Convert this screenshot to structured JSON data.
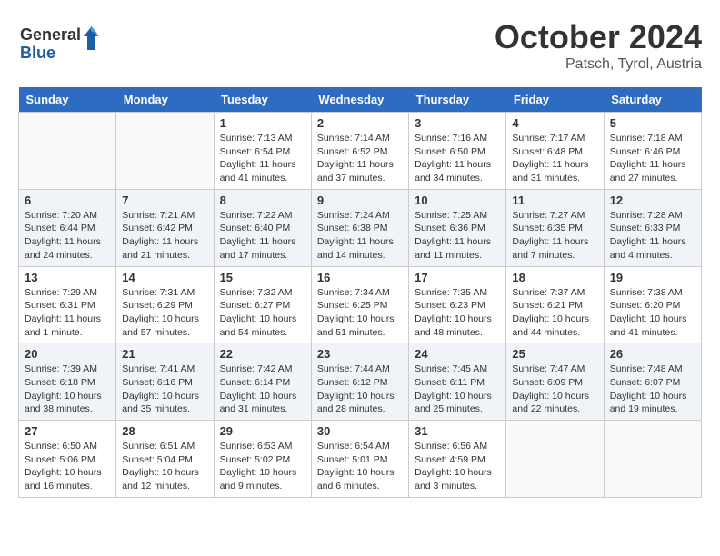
{
  "header": {
    "logo_line1": "General",
    "logo_line2": "Blue",
    "month": "October 2024",
    "location": "Patsch, Tyrol, Austria"
  },
  "weekdays": [
    "Sunday",
    "Monday",
    "Tuesday",
    "Wednesday",
    "Thursday",
    "Friday",
    "Saturday"
  ],
  "weeks": [
    [
      {
        "day": "",
        "sunrise": "",
        "sunset": "",
        "daylight": ""
      },
      {
        "day": "",
        "sunrise": "",
        "sunset": "",
        "daylight": ""
      },
      {
        "day": "1",
        "sunrise": "Sunrise: 7:13 AM",
        "sunset": "Sunset: 6:54 PM",
        "daylight": "Daylight: 11 hours and 41 minutes."
      },
      {
        "day": "2",
        "sunrise": "Sunrise: 7:14 AM",
        "sunset": "Sunset: 6:52 PM",
        "daylight": "Daylight: 11 hours and 37 minutes."
      },
      {
        "day": "3",
        "sunrise": "Sunrise: 7:16 AM",
        "sunset": "Sunset: 6:50 PM",
        "daylight": "Daylight: 11 hours and 34 minutes."
      },
      {
        "day": "4",
        "sunrise": "Sunrise: 7:17 AM",
        "sunset": "Sunset: 6:48 PM",
        "daylight": "Daylight: 11 hours and 31 minutes."
      },
      {
        "day": "5",
        "sunrise": "Sunrise: 7:18 AM",
        "sunset": "Sunset: 6:46 PM",
        "daylight": "Daylight: 11 hours and 27 minutes."
      }
    ],
    [
      {
        "day": "6",
        "sunrise": "Sunrise: 7:20 AM",
        "sunset": "Sunset: 6:44 PM",
        "daylight": "Daylight: 11 hours and 24 minutes."
      },
      {
        "day": "7",
        "sunrise": "Sunrise: 7:21 AM",
        "sunset": "Sunset: 6:42 PM",
        "daylight": "Daylight: 11 hours and 21 minutes."
      },
      {
        "day": "8",
        "sunrise": "Sunrise: 7:22 AM",
        "sunset": "Sunset: 6:40 PM",
        "daylight": "Daylight: 11 hours and 17 minutes."
      },
      {
        "day": "9",
        "sunrise": "Sunrise: 7:24 AM",
        "sunset": "Sunset: 6:38 PM",
        "daylight": "Daylight: 11 hours and 14 minutes."
      },
      {
        "day": "10",
        "sunrise": "Sunrise: 7:25 AM",
        "sunset": "Sunset: 6:36 PM",
        "daylight": "Daylight: 11 hours and 11 minutes."
      },
      {
        "day": "11",
        "sunrise": "Sunrise: 7:27 AM",
        "sunset": "Sunset: 6:35 PM",
        "daylight": "Daylight: 11 hours and 7 minutes."
      },
      {
        "day": "12",
        "sunrise": "Sunrise: 7:28 AM",
        "sunset": "Sunset: 6:33 PM",
        "daylight": "Daylight: 11 hours and 4 minutes."
      }
    ],
    [
      {
        "day": "13",
        "sunrise": "Sunrise: 7:29 AM",
        "sunset": "Sunset: 6:31 PM",
        "daylight": "Daylight: 11 hours and 1 minute."
      },
      {
        "day": "14",
        "sunrise": "Sunrise: 7:31 AM",
        "sunset": "Sunset: 6:29 PM",
        "daylight": "Daylight: 10 hours and 57 minutes."
      },
      {
        "day": "15",
        "sunrise": "Sunrise: 7:32 AM",
        "sunset": "Sunset: 6:27 PM",
        "daylight": "Daylight: 10 hours and 54 minutes."
      },
      {
        "day": "16",
        "sunrise": "Sunrise: 7:34 AM",
        "sunset": "Sunset: 6:25 PM",
        "daylight": "Daylight: 10 hours and 51 minutes."
      },
      {
        "day": "17",
        "sunrise": "Sunrise: 7:35 AM",
        "sunset": "Sunset: 6:23 PM",
        "daylight": "Daylight: 10 hours and 48 minutes."
      },
      {
        "day": "18",
        "sunrise": "Sunrise: 7:37 AM",
        "sunset": "Sunset: 6:21 PM",
        "daylight": "Daylight: 10 hours and 44 minutes."
      },
      {
        "day": "19",
        "sunrise": "Sunrise: 7:38 AM",
        "sunset": "Sunset: 6:20 PM",
        "daylight": "Daylight: 10 hours and 41 minutes."
      }
    ],
    [
      {
        "day": "20",
        "sunrise": "Sunrise: 7:39 AM",
        "sunset": "Sunset: 6:18 PM",
        "daylight": "Daylight: 10 hours and 38 minutes."
      },
      {
        "day": "21",
        "sunrise": "Sunrise: 7:41 AM",
        "sunset": "Sunset: 6:16 PM",
        "daylight": "Daylight: 10 hours and 35 minutes."
      },
      {
        "day": "22",
        "sunrise": "Sunrise: 7:42 AM",
        "sunset": "Sunset: 6:14 PM",
        "daylight": "Daylight: 10 hours and 31 minutes."
      },
      {
        "day": "23",
        "sunrise": "Sunrise: 7:44 AM",
        "sunset": "Sunset: 6:12 PM",
        "daylight": "Daylight: 10 hours and 28 minutes."
      },
      {
        "day": "24",
        "sunrise": "Sunrise: 7:45 AM",
        "sunset": "Sunset: 6:11 PM",
        "daylight": "Daylight: 10 hours and 25 minutes."
      },
      {
        "day": "25",
        "sunrise": "Sunrise: 7:47 AM",
        "sunset": "Sunset: 6:09 PM",
        "daylight": "Daylight: 10 hours and 22 minutes."
      },
      {
        "day": "26",
        "sunrise": "Sunrise: 7:48 AM",
        "sunset": "Sunset: 6:07 PM",
        "daylight": "Daylight: 10 hours and 19 minutes."
      }
    ],
    [
      {
        "day": "27",
        "sunrise": "Sunrise: 6:50 AM",
        "sunset": "Sunset: 5:06 PM",
        "daylight": "Daylight: 10 hours and 16 minutes."
      },
      {
        "day": "28",
        "sunrise": "Sunrise: 6:51 AM",
        "sunset": "Sunset: 5:04 PM",
        "daylight": "Daylight: 10 hours and 12 minutes."
      },
      {
        "day": "29",
        "sunrise": "Sunrise: 6:53 AM",
        "sunset": "Sunset: 5:02 PM",
        "daylight": "Daylight: 10 hours and 9 minutes."
      },
      {
        "day": "30",
        "sunrise": "Sunrise: 6:54 AM",
        "sunset": "Sunset: 5:01 PM",
        "daylight": "Daylight: 10 hours and 6 minutes."
      },
      {
        "day": "31",
        "sunrise": "Sunrise: 6:56 AM",
        "sunset": "Sunset: 4:59 PM",
        "daylight": "Daylight: 10 hours and 3 minutes."
      },
      {
        "day": "",
        "sunrise": "",
        "sunset": "",
        "daylight": ""
      },
      {
        "day": "",
        "sunrise": "",
        "sunset": "",
        "daylight": ""
      }
    ]
  ]
}
